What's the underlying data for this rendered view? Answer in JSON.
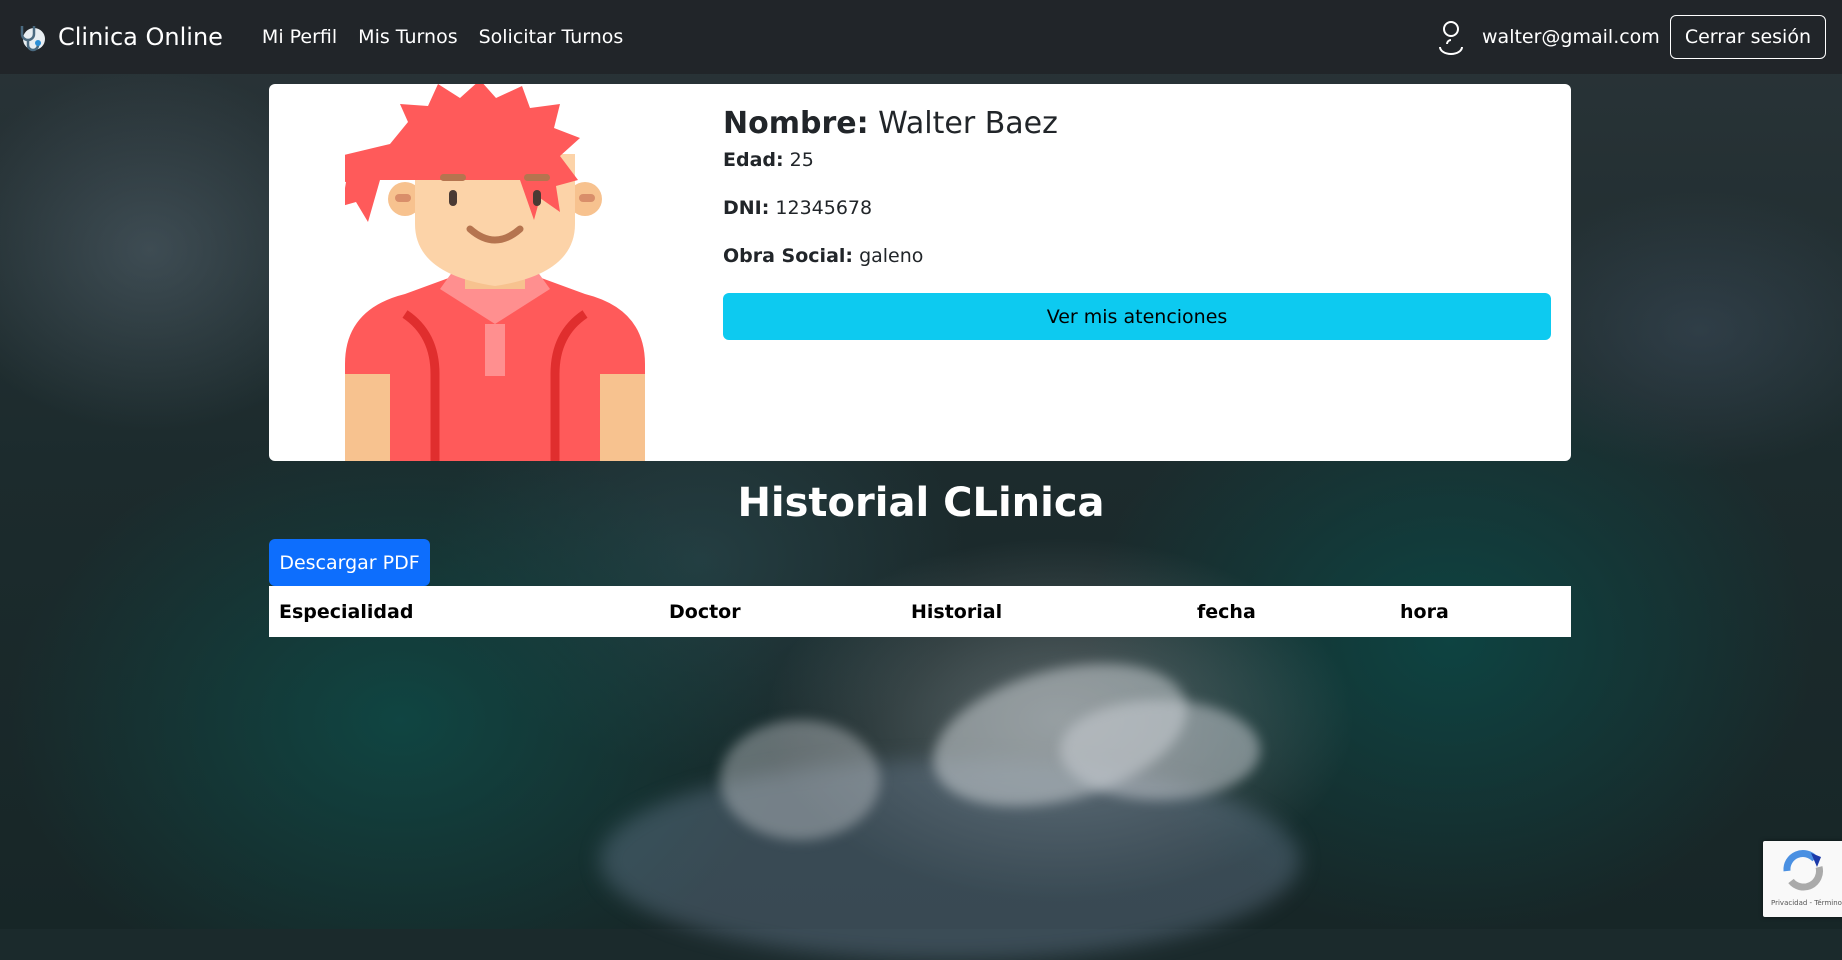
{
  "navbar": {
    "brand": "Clinica Online",
    "links": [
      "Mi Perfil",
      "Mis Turnos",
      "Solicitar Turnos"
    ],
    "user_email": "walter@gmail.com",
    "logout_label": "Cerrar sesión"
  },
  "profile": {
    "name_label": "Nombre:",
    "name": "Walter Baez",
    "age_label": "Edad:",
    "age": "25",
    "dni_label": "DNI:",
    "dni": "12345678",
    "obra_label": "Obra Social:",
    "obra": "galeno",
    "atenciones_button": "Ver mis atenciones"
  },
  "historial": {
    "title": "Historial CLinica",
    "pdf_button": "Descargar PDF",
    "columns": [
      "Especialidad",
      "Doctor",
      "Historial",
      "fecha",
      "hora"
    ]
  },
  "recaptcha": {
    "footer": "Privacidad - Términos"
  },
  "colors": {
    "navbar": "#212529",
    "info_button": "#0dcaf0",
    "primary_button": "#0d6efd"
  }
}
